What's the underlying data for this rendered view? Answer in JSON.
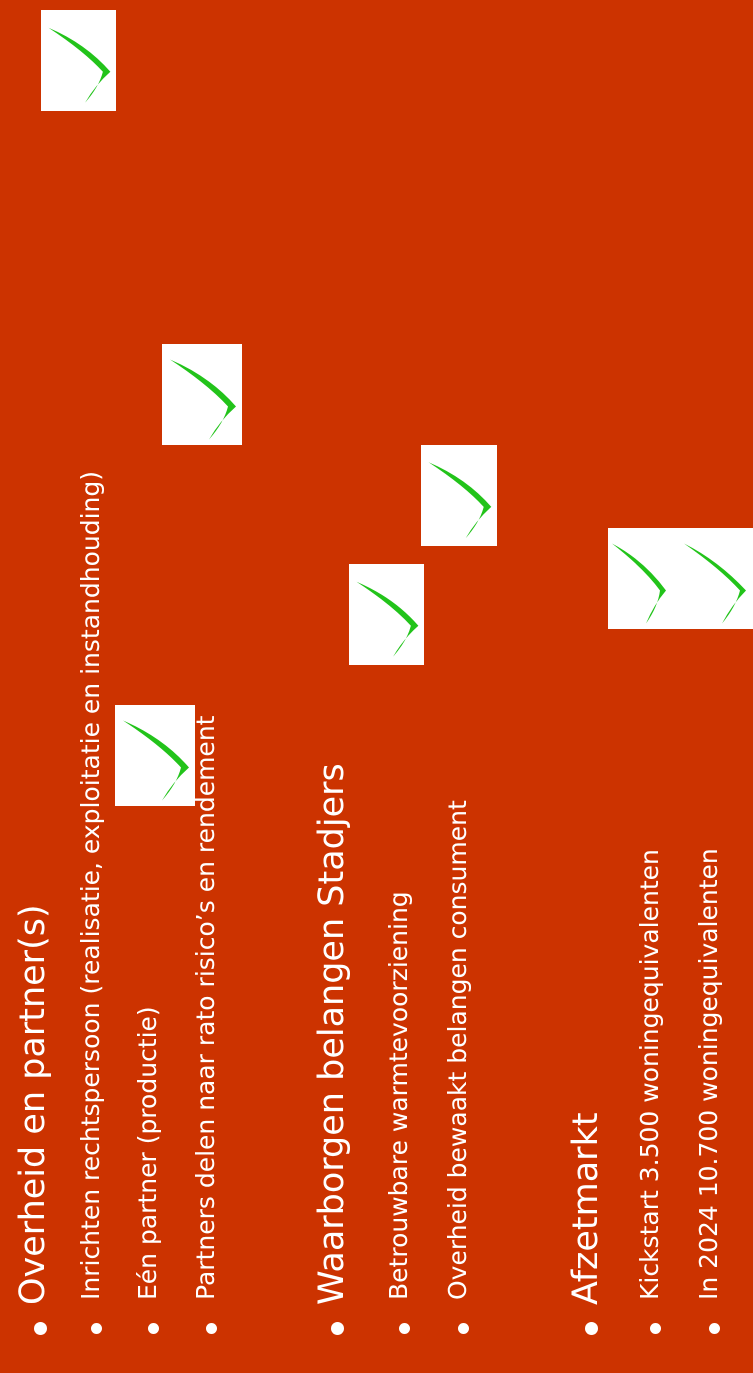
{
  "sections": [
    {
      "heading": "Overheid en partner(s)",
      "items": [
        "Inrichten rechtspersoon (realisatie, exploitatie en instandhouding)",
        "Eén partner (productie)",
        "Partners delen naar rato risico’s en rendement"
      ]
    },
    {
      "heading": "Waarborgen belangen Stadjers",
      "items": [
        "Betrouwbare warmtevoorziening",
        "Overheid bewaakt belangen consument"
      ]
    },
    {
      "heading": "Afzetmarkt",
      "items": [
        "Kickstart 3.500 woningequivalenten",
        "In 2024 10.700 woningequivalenten"
      ]
    }
  ],
  "colors": {
    "background": "#cc3300",
    "text": "#ffffff",
    "check": "#22c31a"
  },
  "icons": [
    "check-icon"
  ]
}
